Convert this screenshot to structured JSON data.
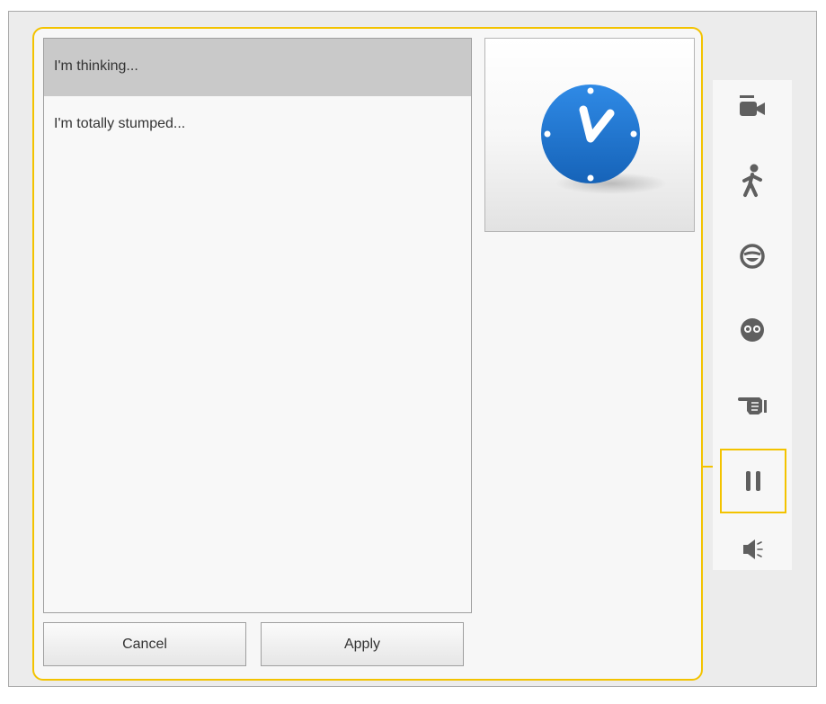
{
  "list": {
    "items": [
      {
        "label": "I'm thinking...",
        "selected": true
      },
      {
        "label": "I'm totally stumped...",
        "selected": false
      }
    ]
  },
  "buttons": {
    "cancel_label": "Cancel",
    "apply_label": "Apply"
  },
  "preview": {
    "icon": "clock-icon"
  },
  "toolbar": {
    "tools": [
      {
        "icon": "camera-icon"
      },
      {
        "icon": "walking-figure-icon"
      },
      {
        "icon": "smiley-face-icon"
      },
      {
        "icon": "surprised-face-icon"
      },
      {
        "icon": "pointing-hand-icon"
      },
      {
        "icon": "pause-icon",
        "selected": true
      },
      {
        "icon": "speaker-icon"
      }
    ]
  },
  "colors": {
    "accent": "#f3c300",
    "clock_blue": "#1e78d2",
    "icon_gray": "#5f5f5f",
    "selected_row": "#c9c9c9"
  }
}
